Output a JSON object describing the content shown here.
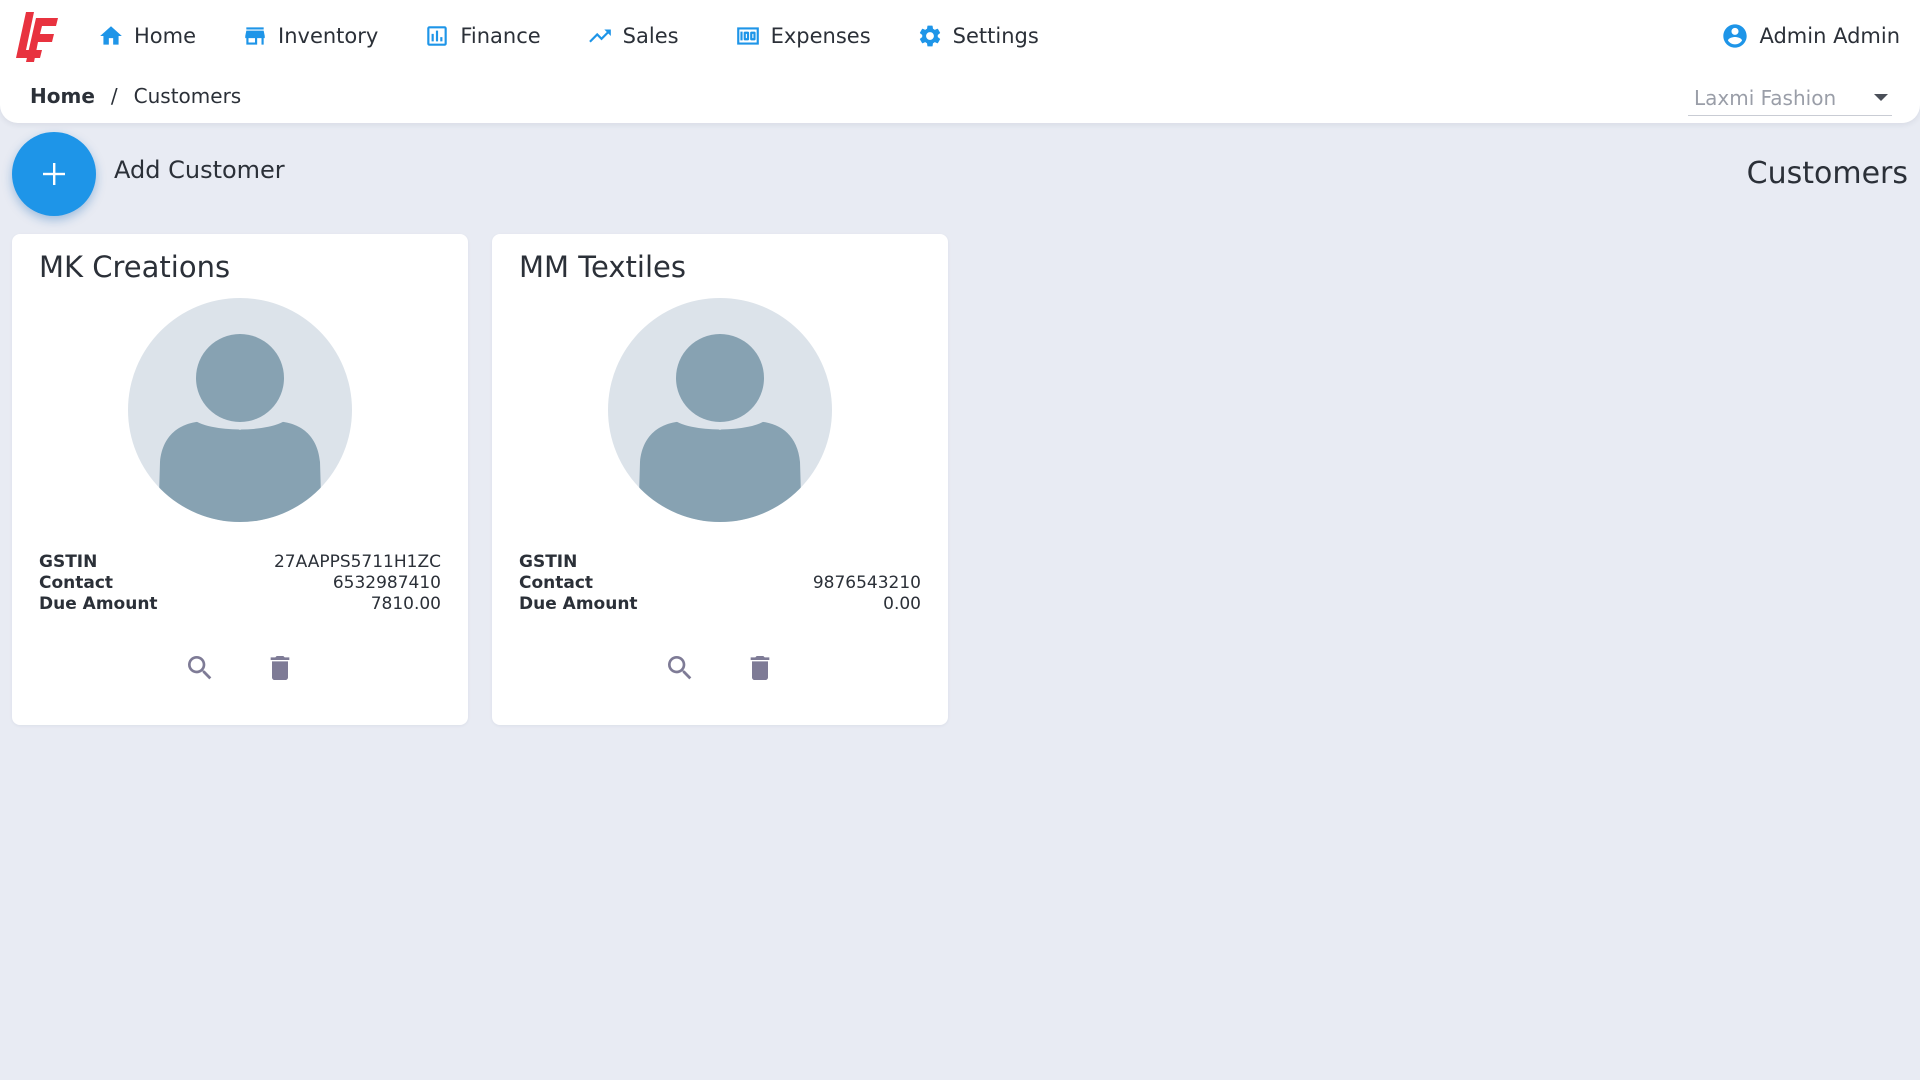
{
  "colors": {
    "accent": "#1e95e8",
    "logo": "#e8323f",
    "background": "#e8ebf3",
    "avatar_bg": "#dce3ea",
    "avatar_fg": "#87a2b2",
    "action_icon": "#7e7b96"
  },
  "nav": {
    "items": [
      {
        "label": "Home",
        "icon": "home-icon"
      },
      {
        "label": "Inventory",
        "icon": "store-icon"
      },
      {
        "label": "Finance",
        "icon": "bar-chart-icon"
      },
      {
        "label": "Sales",
        "icon": "trending-up-icon"
      },
      {
        "label": "Expenses",
        "icon": "money-icon"
      },
      {
        "label": "Settings",
        "icon": "gear-icon"
      }
    ]
  },
  "user": {
    "name": "Admin Admin",
    "icon": "account-circle-icon"
  },
  "breadcrumb": {
    "home": "Home",
    "separator": "/",
    "current": "Customers"
  },
  "company_select": {
    "value": "Laxmi Fashion"
  },
  "actions": {
    "add_label": "Add Customer",
    "add_icon": "plus-icon"
  },
  "page_title": "Customers",
  "customers": [
    {
      "name": "MK Creations",
      "gstin_label": "GSTIN",
      "gstin": "27AAPPS5711H1ZC",
      "contact_label": "Contact",
      "contact": "6532987410",
      "due_label": "Due Amount",
      "due": "7810.00"
    },
    {
      "name": "MM Textiles",
      "gstin_label": "GSTIN",
      "gstin": "",
      "contact_label": "Contact",
      "contact": "9876543210",
      "due_label": "Due Amount",
      "due": "0.00"
    }
  ]
}
